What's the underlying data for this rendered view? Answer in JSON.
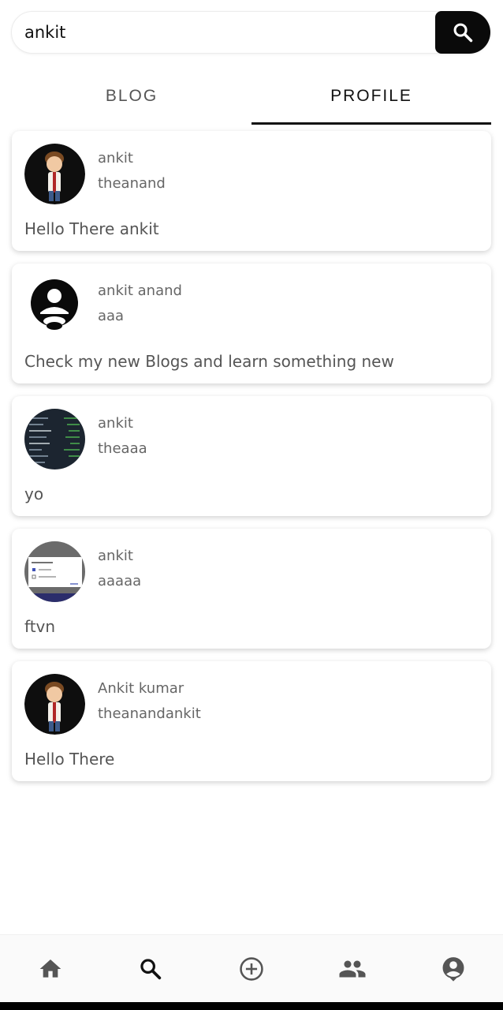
{
  "search": {
    "value": "ankit"
  },
  "tabs": [
    {
      "label": "BLOG"
    },
    {
      "label": "PROFILE"
    }
  ],
  "active_tab": "PROFILE",
  "results": [
    {
      "name": "ankit",
      "username": "theanand",
      "bio": "Hello There ankit",
      "avatar": "cartoon-boy"
    },
    {
      "name": "ankit anand",
      "username": "aaa",
      "bio": "Check my new Blogs and learn something new",
      "avatar": "default-user"
    },
    {
      "name": "ankit",
      "username": "theaaa",
      "bio": "yo",
      "avatar": "code-screenshot"
    },
    {
      "name": "ankit",
      "username": "aaaaa",
      "bio": "ftvn",
      "avatar": "dialog-screenshot"
    },
    {
      "name": "Ankit kumar",
      "username": "theanandankit",
      "bio": "Hello There",
      "avatar": "cartoon-boy"
    }
  ],
  "bottom_nav": [
    {
      "icon": "home-icon"
    },
    {
      "icon": "search-icon"
    },
    {
      "icon": "add-circle-icon"
    },
    {
      "icon": "people-icon"
    },
    {
      "icon": "account-icon"
    }
  ],
  "colors": {
    "accent": "#0a0a0a",
    "background": "#ffffff",
    "nav_icon": "#555555"
  }
}
